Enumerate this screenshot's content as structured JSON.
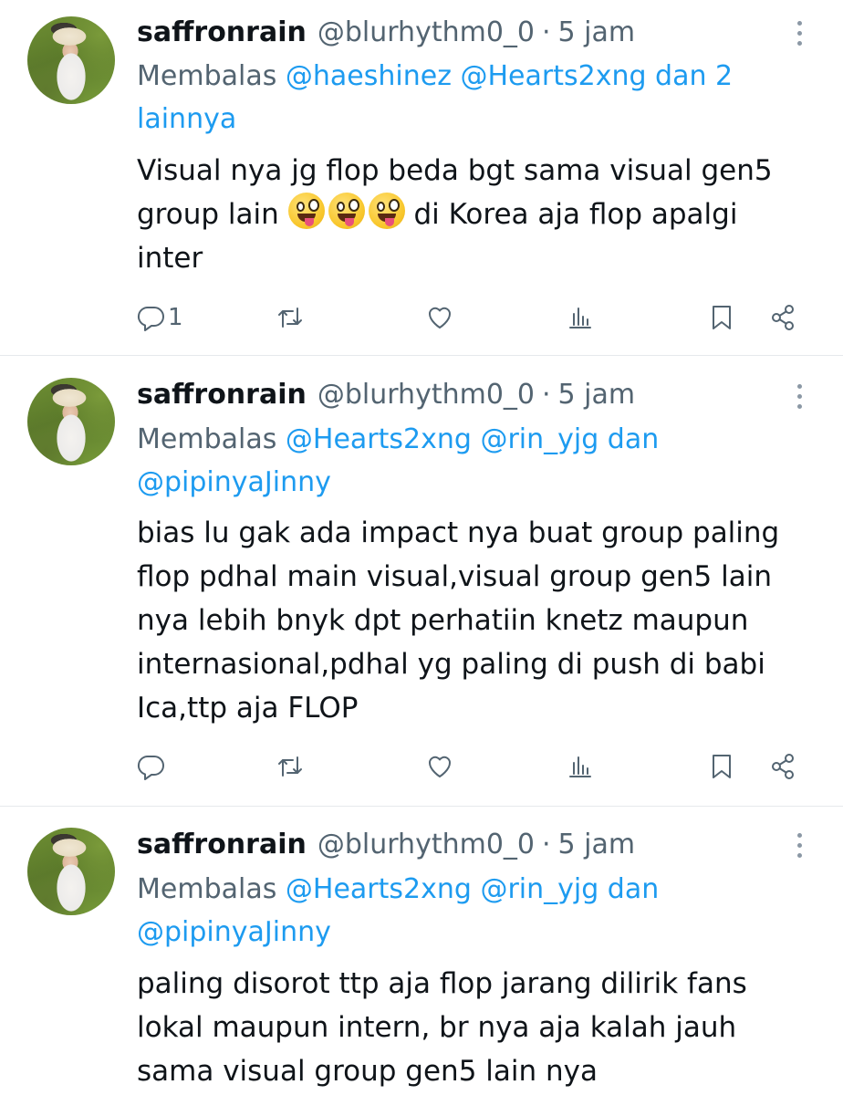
{
  "tweets": [
    {
      "name": "saffronrain",
      "handle": "@blurhythm0_0",
      "dot": "·",
      "time": "5 jam",
      "reply_prefix": "Membalas",
      "reply_mentions": "@haeshinez @Hearts2xng dan 2",
      "reply_suffix": "lainnya",
      "body_1": "Visual nya jg flop beda bgt sama visual gen5",
      "body_2a": "group lain",
      "body_2b": "di Korea aja flop apalgi",
      "body_3": "inter",
      "reply_count": "1"
    },
    {
      "name": "saffronrain",
      "handle": "@blurhythm0_0",
      "dot": "·",
      "time": "5 jam",
      "reply_prefix": "Membalas",
      "reply_mentions": "@Hearts2xng @rin_yjg dan",
      "reply_line2": "@pipinyaJinny",
      "body_1": "bias lu gak ada impact nya buat group paling",
      "body_2": "flop pdhal main visual,visual group gen5 lain",
      "body_3": "nya lebih bnyk dpt perhatiin knetz maupun",
      "body_4": "internasional,pdhal yg paling di push di babi",
      "body_5": "Ica,ttp aja FLOP",
      "reply_count": ""
    },
    {
      "name": "saffronrain",
      "handle": "@blurhythm0_0",
      "dot": "·",
      "time": "5 jam",
      "reply_prefix": "Membalas",
      "reply_mentions": "@Hearts2xng @rin_yjg dan",
      "reply_line2": "@pipinyaJinny",
      "body_1": "paling disorot ttp aja flop jarang dilirik fans",
      "body_2": "lokal maupun intern, br nya aja kalah jauh",
      "body_3": "sama visual group gen5 lain nya"
    }
  ],
  "icons": {
    "reply": "reply-icon",
    "retweet": "retweet-icon",
    "like": "like-icon",
    "views": "views-icon",
    "bookmark": "bookmark-icon",
    "share": "share-icon",
    "more": "more-icon",
    "emoji": "zany-face-emoji"
  },
  "colors": {
    "mention": "#1d9bf0",
    "secondary": "#536471",
    "text": "#0f1419",
    "divider": "#e6e9ec"
  }
}
